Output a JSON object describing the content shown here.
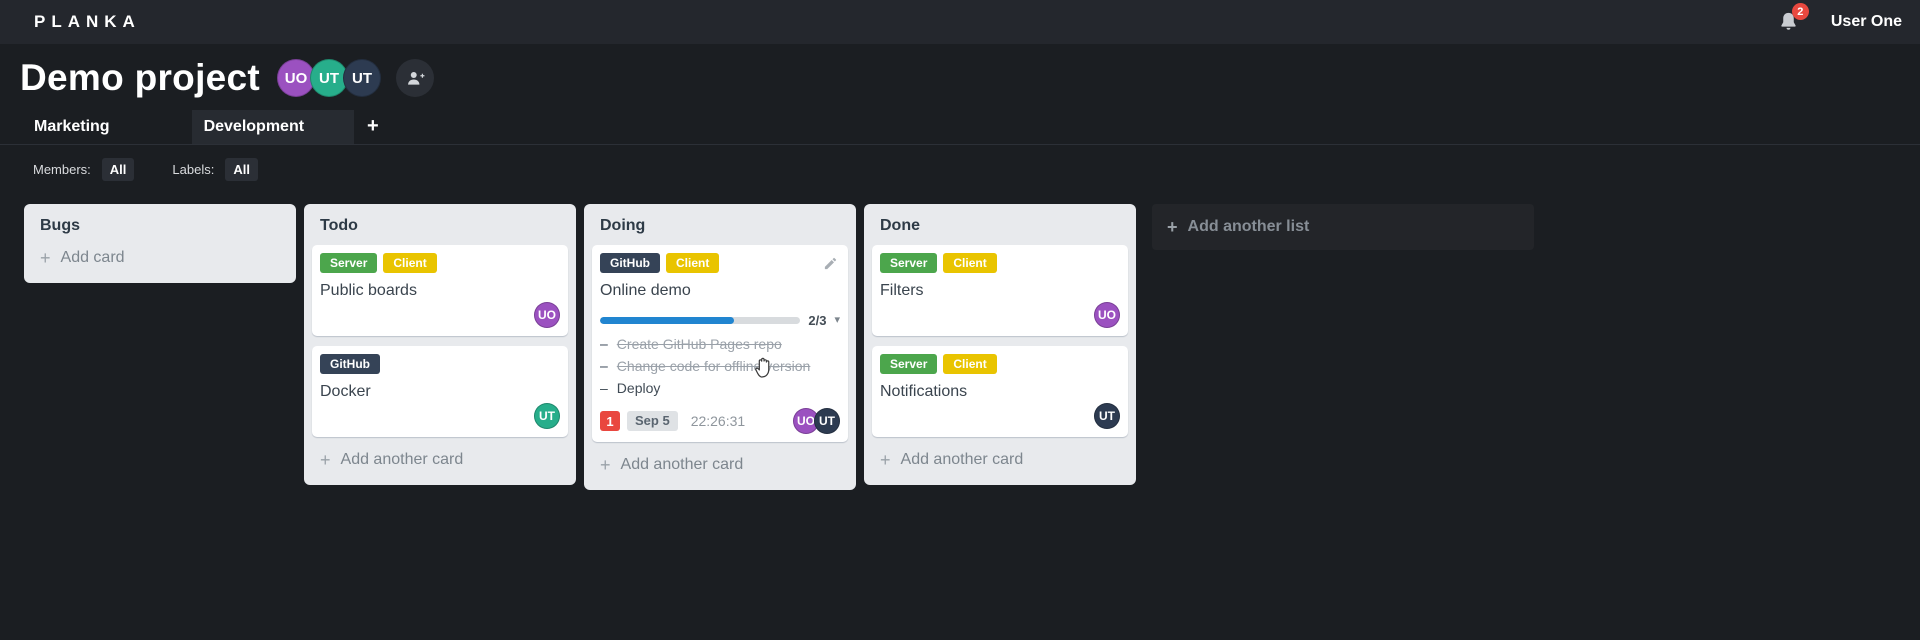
{
  "icons": {
    "plus": "+",
    "caret_down": "▾",
    "task_dash": "–"
  },
  "topbar": {
    "logo": "PLANKA",
    "notifications_count": "2",
    "user_name": "User One"
  },
  "project": {
    "title": "Demo project",
    "members": [
      {
        "initials": "UO",
        "color": "#9b51c0"
      },
      {
        "initials": "UT",
        "color": "#27ae8b"
      },
      {
        "initials": "UT",
        "color": "#2d3b51"
      }
    ]
  },
  "tabs": {
    "items": [
      {
        "label": "Marketing",
        "active": false
      },
      {
        "label": "Development",
        "active": true
      }
    ]
  },
  "filters": {
    "members_label": "Members:",
    "members_value": "All",
    "labels_label": "Labels:",
    "labels_value": "All"
  },
  "board": {
    "add_list_label": "Add another list",
    "lists": [
      {
        "title": "Bugs",
        "add_card_label": "Add card",
        "cards": []
      },
      {
        "title": "Todo",
        "add_card_label": "Add another card",
        "cards": [
          {
            "title": "Public boards",
            "labels": [
              {
                "text": "Server",
                "color": "#4ca64c"
              },
              {
                "text": "Client",
                "color": "#e9c400"
              }
            ],
            "members": [
              {
                "initials": "UO",
                "color": "#9b51c0"
              }
            ]
          },
          {
            "title": "Docker",
            "labels": [
              {
                "text": "GitHub",
                "color": "#354357"
              }
            ],
            "members": [
              {
                "initials": "UT",
                "color": "#27ae8b"
              }
            ]
          }
        ]
      },
      {
        "title": "Doing",
        "add_card_label": "Add another card",
        "cards": [
          {
            "title": "Online demo",
            "labels": [
              {
                "text": "GitHub",
                "color": "#354357"
              },
              {
                "text": "Client",
                "color": "#e9c400"
              }
            ],
            "edit_icon": true,
            "progress": {
              "done": 2,
              "total": 3,
              "label": "2/3",
              "percent": 66.7
            },
            "tasks": [
              {
                "text": "Create GitHub Pages repo",
                "done": true
              },
              {
                "text": "Change code for offline version",
                "done": true
              },
              {
                "text": "Deploy",
                "done": false
              }
            ],
            "notifications": "1",
            "due_date": "Sep 5",
            "timer": "22:26:31",
            "members": [
              {
                "initials": "UO",
                "color": "#9b51c0"
              },
              {
                "initials": "UT",
                "color": "#2d3b51"
              }
            ]
          }
        ]
      },
      {
        "title": "Done",
        "add_card_label": "Add another card",
        "cards": [
          {
            "title": "Filters",
            "labels": [
              {
                "text": "Server",
                "color": "#4ca64c"
              },
              {
                "text": "Client",
                "color": "#e9c400"
              }
            ],
            "members": [
              {
                "initials": "UO",
                "color": "#9b51c0"
              }
            ]
          },
          {
            "title": "Notifications",
            "labels": [
              {
                "text": "Server",
                "color": "#4ca64c"
              },
              {
                "text": "Client",
                "color": "#e9c400"
              }
            ],
            "members": [
              {
                "initials": "UT",
                "color": "#2d3b51"
              }
            ]
          }
        ]
      }
    ]
  },
  "colors": {
    "topbar_bg": "#24272d",
    "page_bg": "#1b1e22",
    "list_bg": "#e8eaed",
    "progress_bar": "#2185d0",
    "notification_badge": "#e9473f",
    "label_green": "#4ca64c",
    "label_yellow": "#e9c400",
    "label_dark": "#354357",
    "avatar_purple": "#9b51c0",
    "avatar_teal": "#27ae8b",
    "avatar_dark": "#2d3b51"
  }
}
